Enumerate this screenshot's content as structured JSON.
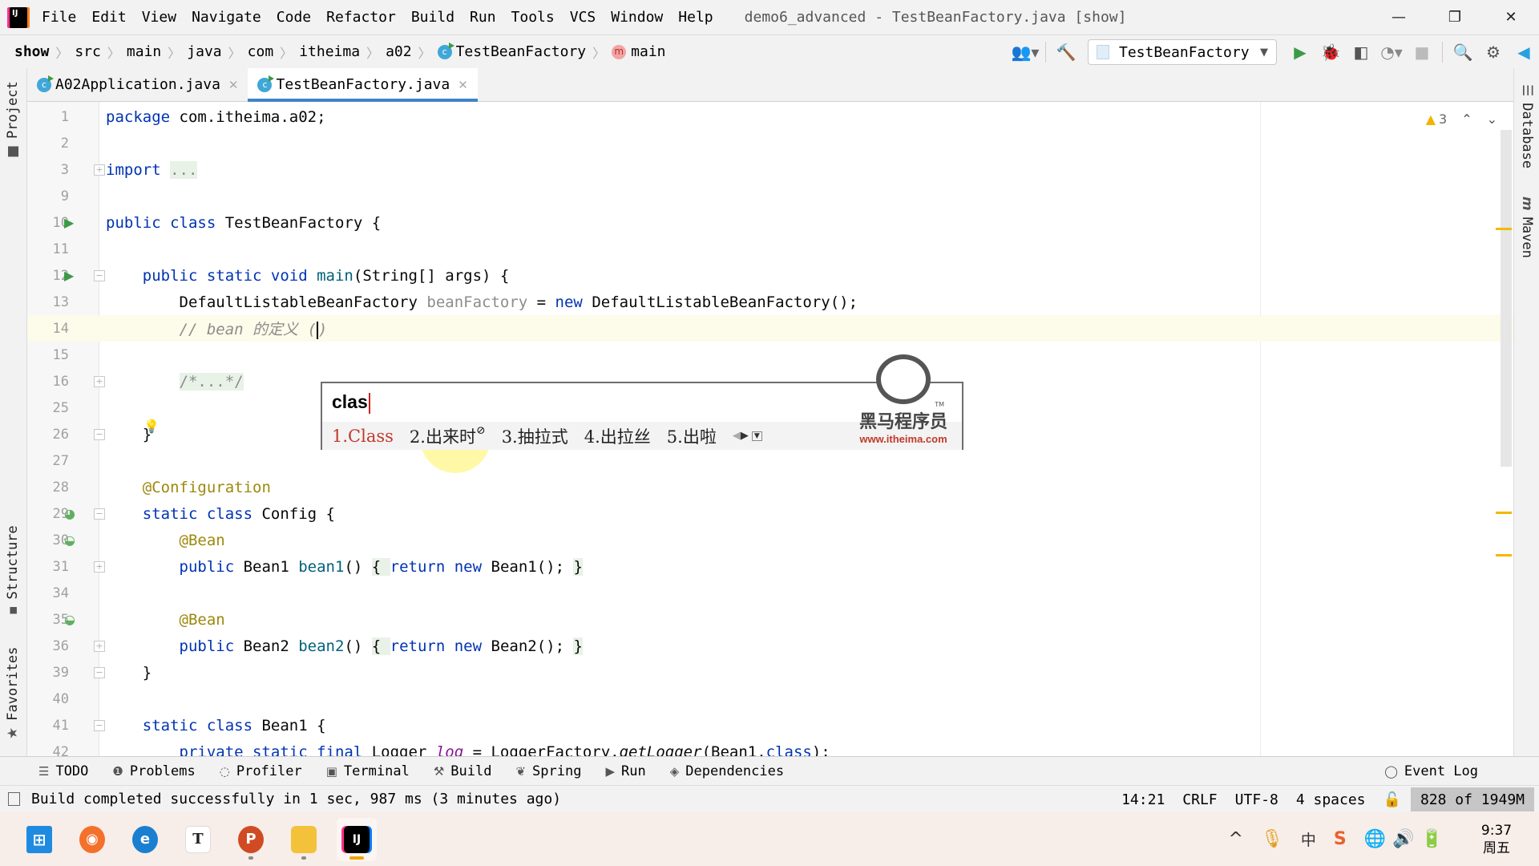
{
  "menubar": {
    "items": [
      "File",
      "Edit",
      "View",
      "Navigate",
      "Code",
      "Refactor",
      "Build",
      "Run",
      "Tools",
      "VCS",
      "Window",
      "Help"
    ],
    "window_title": "demo6_advanced - TestBeanFactory.java [show]",
    "controls": {
      "minimize": "—",
      "restore": "❐",
      "close": "✕"
    }
  },
  "navbar": {
    "breadcrumbs": [
      "show",
      "src",
      "main",
      "java",
      "com",
      "itheima",
      "a02",
      "TestBeanFactory",
      "main"
    ],
    "run_config": "TestBeanFactory"
  },
  "tabs": [
    {
      "label": "A02Application.java",
      "active": false
    },
    {
      "label": "TestBeanFactory.java",
      "active": true
    }
  ],
  "left_strip": {
    "project": "Project",
    "structure": "Structure",
    "favorites": "Favorites"
  },
  "right_strip": {
    "database": "Database",
    "maven": "Maven"
  },
  "editor": {
    "inspection_warnings": "3",
    "lines": [
      {
        "n": "1",
        "tokens": [
          [
            "kw",
            "package "
          ],
          [
            "",
            "com.itheima.a02;"
          ]
        ]
      },
      {
        "n": "2",
        "tokens": []
      },
      {
        "n": "3",
        "tokens": [
          [
            "kw",
            "import "
          ],
          [
            "fold-bg grey",
            "..."
          ]
        ]
      },
      {
        "n": "9",
        "tokens": []
      },
      {
        "n": "10",
        "tokens": [
          [
            "kw",
            "public class "
          ],
          [
            "",
            "TestBeanFactory {"
          ]
        ]
      },
      {
        "n": "11",
        "tokens": []
      },
      {
        "n": "12",
        "tokens": [
          [
            "",
            "    "
          ],
          [
            "kw",
            "public static void "
          ],
          [
            "fn",
            "main"
          ],
          [
            "",
            "(String[] args) {"
          ]
        ]
      },
      {
        "n": "13",
        "tokens": [
          [
            "",
            "        DefaultListableBeanFactory "
          ],
          [
            "grey",
            "beanFactory"
          ],
          [
            "",
            " = "
          ],
          [
            "kw",
            "new "
          ],
          [
            "",
            "DefaultListableBeanFactory();"
          ]
        ]
      },
      {
        "n": "14",
        "tokens": [
          [
            "",
            "        "
          ],
          [
            "cmt",
            "// bean 的定义 ("
          ],
          [
            "caret",
            ""
          ],
          [
            "cmt",
            ")"
          ]
        ]
      },
      {
        "n": "15",
        "tokens": []
      },
      {
        "n": "16",
        "tokens": [
          [
            "",
            "        "
          ],
          [
            "fold-bg grey",
            "/*...*/"
          ]
        ]
      },
      {
        "n": "25",
        "tokens": []
      },
      {
        "n": "26",
        "tokens": [
          [
            "",
            "    }"
          ]
        ]
      },
      {
        "n": "27",
        "tokens": []
      },
      {
        "n": "28",
        "tokens": [
          [
            "",
            "    "
          ],
          [
            "ann",
            "@Configuration"
          ]
        ]
      },
      {
        "n": "29",
        "tokens": [
          [
            "",
            "    "
          ],
          [
            "kw",
            "static class "
          ],
          [
            "",
            "Config {"
          ]
        ]
      },
      {
        "n": "30",
        "tokens": [
          [
            "",
            "        "
          ],
          [
            "ann",
            "@Bean"
          ]
        ]
      },
      {
        "n": "31",
        "tokens": [
          [
            "",
            "        "
          ],
          [
            "kw",
            "public "
          ],
          [
            "",
            "Bean1 "
          ],
          [
            "fn",
            "bean1"
          ],
          [
            "",
            "() "
          ],
          [
            "fold-bg",
            "{ "
          ],
          [
            "kw",
            "return new "
          ],
          [
            "",
            "Bean1(); "
          ],
          [
            "fold-bg",
            "}"
          ]
        ]
      },
      {
        "n": "34",
        "tokens": []
      },
      {
        "n": "35",
        "tokens": [
          [
            "",
            "        "
          ],
          [
            "ann",
            "@Bean"
          ]
        ]
      },
      {
        "n": "36",
        "tokens": [
          [
            "",
            "        "
          ],
          [
            "kw",
            "public "
          ],
          [
            "",
            "Bean2 "
          ],
          [
            "fn",
            "bean2"
          ],
          [
            "",
            "() "
          ],
          [
            "fold-bg",
            "{ "
          ],
          [
            "kw",
            "return new "
          ],
          [
            "",
            "Bean2(); "
          ],
          [
            "fold-bg",
            "}"
          ]
        ]
      },
      {
        "n": "39",
        "tokens": [
          [
            "",
            "    }"
          ]
        ]
      },
      {
        "n": "40",
        "tokens": []
      },
      {
        "n": "41",
        "tokens": [
          [
            "",
            "    "
          ],
          [
            "kw",
            "static class "
          ],
          [
            "",
            "Bean1 {"
          ]
        ]
      },
      {
        "n": "42",
        "tokens": [
          [
            "",
            "        "
          ],
          [
            "kw",
            "private static final "
          ],
          [
            "",
            "Logger "
          ],
          [
            "fieldi",
            "log"
          ],
          [
            "",
            " = LoggerFactory."
          ],
          [
            "itl",
            "getLogger"
          ],
          [
            "",
            "(Bean1."
          ],
          [
            "kw",
            "class"
          ],
          [
            "",
            ");"
          ]
        ]
      }
    ]
  },
  "ime": {
    "input": "clas",
    "candidates": [
      "1.Class",
      "2.出来时",
      "3.抽拉式",
      "4.出拉丝",
      "5.出啦"
    ],
    "selected_index": 0,
    "brand": "黑马程序员",
    "brand_url": "www.itheima.com",
    "tm": "TM"
  },
  "bottom_tools": [
    "TODO",
    "Problems",
    "Profiler",
    "Terminal",
    "Build",
    "Spring",
    "Run",
    "Dependencies"
  ],
  "event_log": "Event Log",
  "status": {
    "message": "Build completed successfully in 1 sec, 987 ms (3 minutes ago)",
    "position": "14:21",
    "line_sep": "CRLF",
    "encoding": "UTF-8",
    "indent": "4 spaces",
    "memory": "828 of 1949M"
  },
  "taskbar": {
    "clock_time": "9:37",
    "clock_day": "周五",
    "ime_mode": "中"
  },
  "colors": {
    "accent": "#4083c9",
    "keyword": "#0033b3",
    "annotation": "#9e880d",
    "warning": "#f1b900"
  }
}
